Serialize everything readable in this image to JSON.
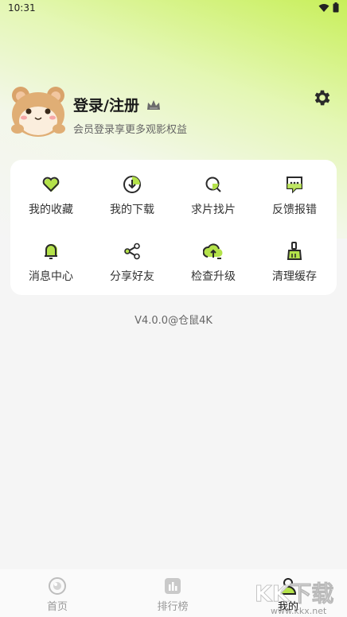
{
  "status_bar": {
    "time": "10:31"
  },
  "profile": {
    "title": "登录/注册",
    "subtitle": "会员登录享更多观影权益"
  },
  "menu": [
    {
      "label": "我的收藏",
      "icon": "heart-icon"
    },
    {
      "label": "我的下载",
      "icon": "download-icon"
    },
    {
      "label": "求片找片",
      "icon": "search-film-icon"
    },
    {
      "label": "反馈报错",
      "icon": "feedback-icon"
    },
    {
      "label": "消息中心",
      "icon": "bell-icon"
    },
    {
      "label": "分享好友",
      "icon": "share-icon"
    },
    {
      "label": "检查升级",
      "icon": "upgrade-icon"
    },
    {
      "label": "清理缓存",
      "icon": "clean-icon"
    }
  ],
  "version": "V4.0.0@仓鼠4K",
  "tabs": [
    {
      "label": "首页",
      "icon": "home-icon",
      "active": false
    },
    {
      "label": "排行榜",
      "icon": "ranking-icon",
      "active": false
    },
    {
      "label": "我的",
      "icon": "profile-icon",
      "active": true
    }
  ],
  "watermark": {
    "text": "KK下载",
    "url_text": "www.kkx.net"
  },
  "colors": {
    "accent": "#b4e24a",
    "background": "#f5f5f5",
    "card": "#ffffff"
  }
}
